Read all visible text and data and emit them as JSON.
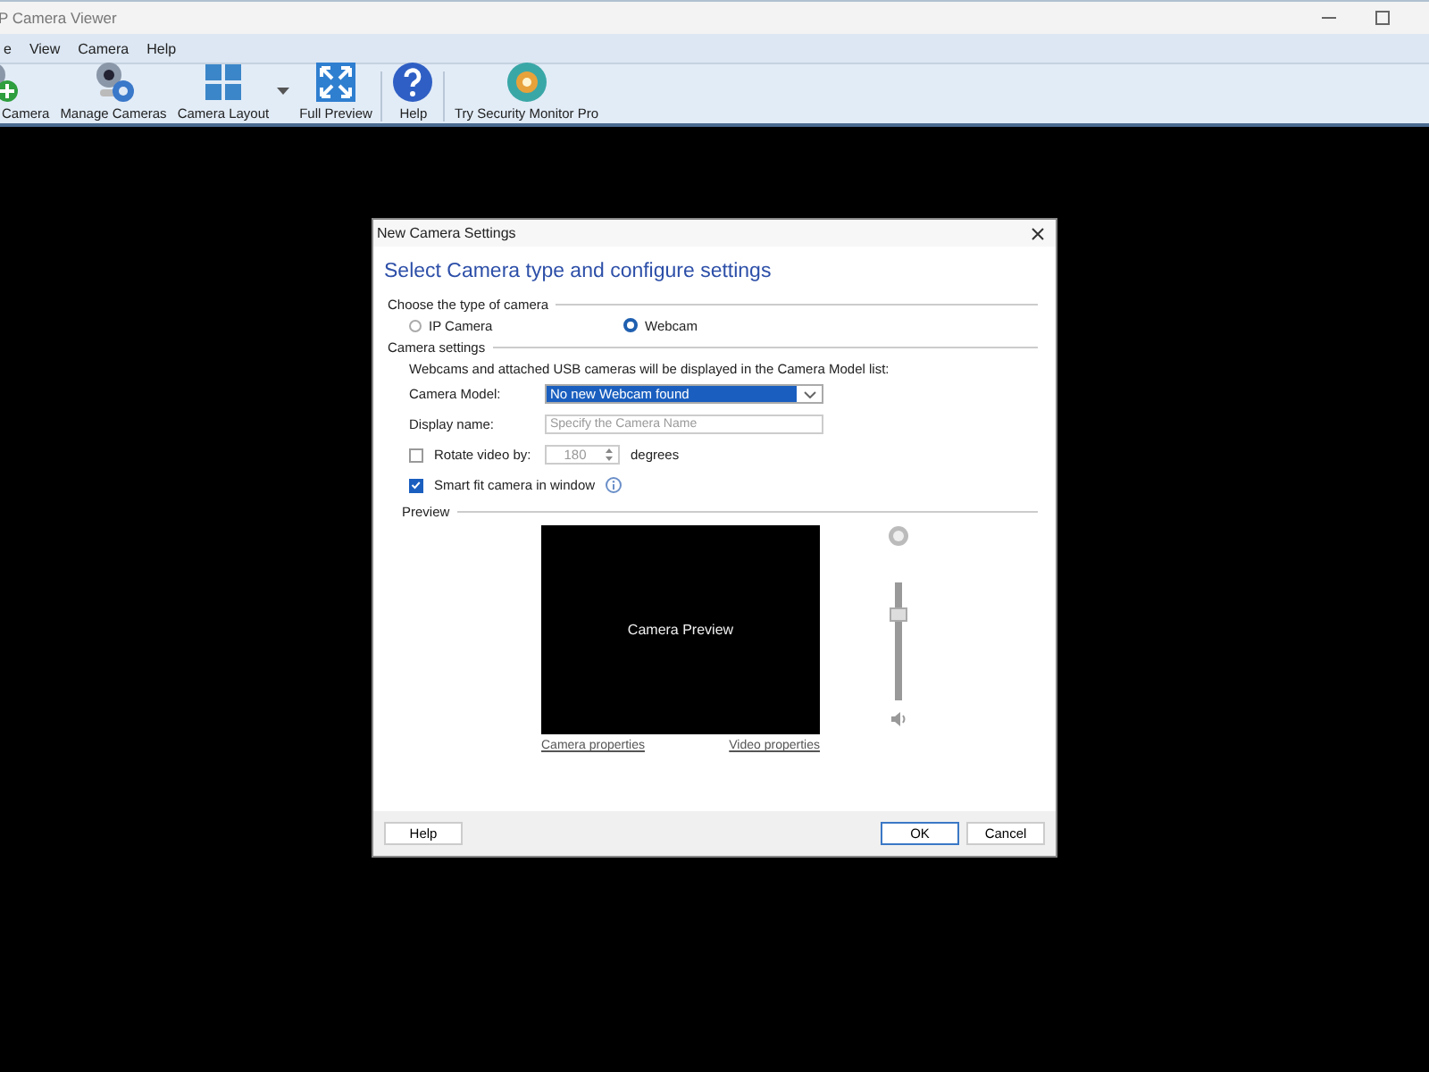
{
  "window": {
    "title": "P Camera Viewer"
  },
  "menu": [
    "e",
    "View",
    "Camera",
    "Help"
  ],
  "toolbar": [
    {
      "label": "Camera",
      "dropdown": false,
      "separator_after": false
    },
    {
      "label": "Manage Cameras",
      "dropdown": false,
      "separator_after": false
    },
    {
      "label": "Camera Layout",
      "dropdown": true,
      "separator_after": false
    },
    {
      "label": "Full Preview",
      "dropdown": false,
      "separator_after": true
    },
    {
      "label": "Help",
      "dropdown": false,
      "separator_after": true
    },
    {
      "label": "Try Security Monitor Pro",
      "dropdown": false,
      "separator_after": false
    }
  ],
  "dialog": {
    "title": "New Camera Settings",
    "heading": "Select Camera type and configure settings",
    "camera_type": {
      "legend": "Choose the type of camera",
      "options": [
        {
          "label": "IP Camera",
          "selected": false
        },
        {
          "label": "Webcam",
          "selected": true
        }
      ]
    },
    "camera_settings": {
      "legend": "Camera settings",
      "note": "Webcams and attached USB cameras will be displayed in the Camera Model list:",
      "camera_model": {
        "label": "Camera Model:",
        "value": "No new Webcam found"
      },
      "display_name": {
        "label": "Display name:",
        "placeholder": "Specify the Camera Name"
      },
      "rotate": {
        "label": "Rotate video by:",
        "checked": false,
        "value": "180",
        "disabled": true,
        "unit": "degrees"
      },
      "smart_fit": {
        "label": "Smart fit camera in window",
        "checked": true
      }
    },
    "preview": {
      "legend": "Preview",
      "screen_text": "Camera Preview",
      "volume": {
        "level": 0.72
      },
      "links": [
        "Camera properties",
        "Video properties"
      ]
    },
    "buttons": [
      {
        "label": "Help",
        "default": false
      },
      {
        "label": "OK",
        "default": true
      },
      {
        "label": "Cancel",
        "default": false
      }
    ]
  }
}
